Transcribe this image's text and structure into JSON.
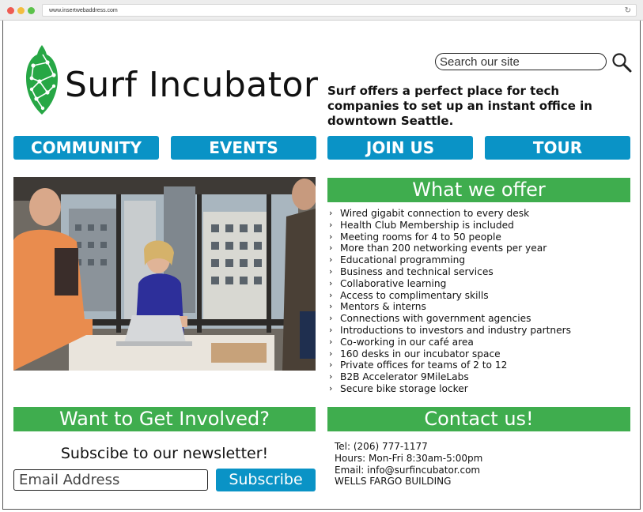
{
  "browser": {
    "url": "www.insertwebaddress.com"
  },
  "header": {
    "logo_text": "Surf Incubator",
    "search_placeholder": "Search our site",
    "tagline": "Surf offers a perfect place for tech companies to set up an instant office in downtown Seattle."
  },
  "nav": {
    "items": [
      {
        "label": "COMMUNITY"
      },
      {
        "label": "EVENTS"
      },
      {
        "label": "JOIN US"
      },
      {
        "label": "TOUR"
      }
    ]
  },
  "offer": {
    "title": "What we offer",
    "items": [
      "Wired gigabit connection to every desk",
      "Health Club Membership is included",
      "Meeting rooms for 4 to 50 people",
      "More than 200 networking events per year",
      "Educational programming",
      "Business and technical services",
      "Collaborative learning",
      "Access to complimentary skills",
      "Mentors & interns",
      "Connections with government agencies",
      "Introductions to investors and industry partners",
      "Co-working in our café area",
      "160 desks in our incubator space",
      "Private offices for teams of 2 to 12",
      "B2B Accelerator 9MileLabs",
      "Secure bike storage locker"
    ]
  },
  "involved": {
    "title": "Want to Get Involved?",
    "newsletter_label": "Subscibe to our newsletter!",
    "email_placeholder": "Email Address",
    "subscribe_label": "Subscribe"
  },
  "contact": {
    "title": "Contact us!",
    "tel": "Tel: (206) 777-1177",
    "hours": "Hours: Mon-Fri 8:30am-5:00pm",
    "email": "Email: info@surfincubator.com",
    "building": "WELLS FARGO BUILDING"
  },
  "colors": {
    "nav_blue": "#0a93c6",
    "section_green": "#3fad4e",
    "logo_green": "#27a745"
  }
}
